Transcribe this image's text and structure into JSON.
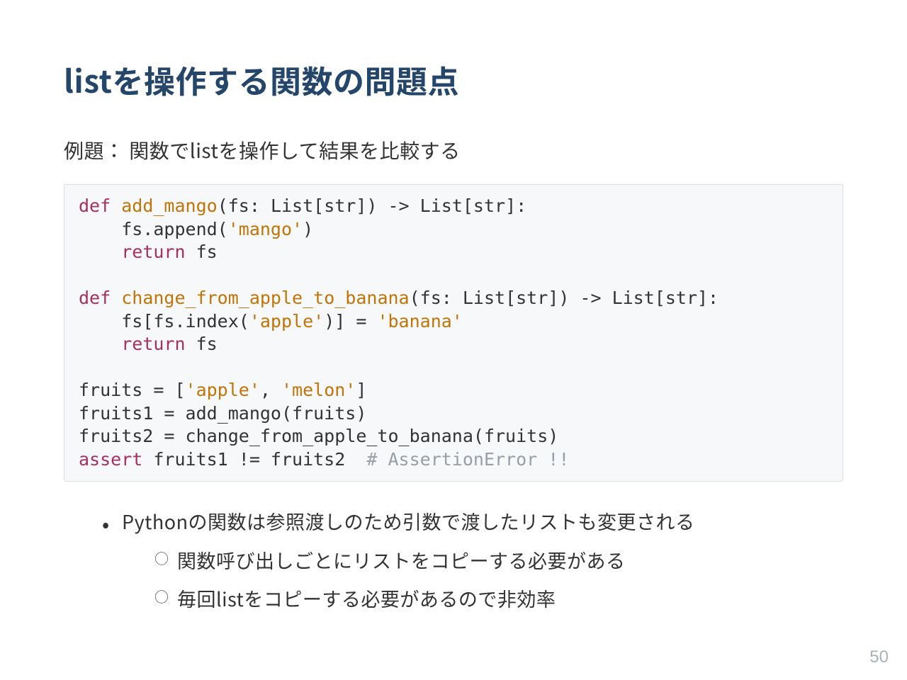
{
  "title": "listを操作する関数の問題点",
  "subtitle": "例題： 関数でlistを操作して結果を比較する",
  "code": {
    "l1a": "def",
    "l1b": "add_mango",
    "l1c": "(fs: List[str]) -> List[str]:",
    "l2a": "    fs.append(",
    "l2b": "'mango'",
    "l2c": ")",
    "l3a": "    ",
    "l3b": "return",
    "l3c": " fs",
    "l5a": "def",
    "l5b": "change_from_apple_to_banana",
    "l5c": "(fs: List[str]) -> List[str]:",
    "l6a": "    fs[fs.index(",
    "l6b": "'apple'",
    "l6c": ")] = ",
    "l6d": "'banana'",
    "l7a": "    ",
    "l7b": "return",
    "l7c": " fs",
    "l9a": "fruits = [",
    "l9b": "'apple'",
    "l9c": ", ",
    "l9d": "'melon'",
    "l9e": "]",
    "l10": "fruits1 = add_mango(fruits)",
    "l11": "fruits2 = change_from_apple_to_banana(fruits)",
    "l12a": "assert",
    "l12b": " fruits1 != fruits2  ",
    "l12c": "# AssertionError !!"
  },
  "bullets": {
    "b1": "Pythonの関数は参照渡しのため引数で渡したリストも変更される",
    "b1_1": "関数呼び出しごとにリストをコピーする必要がある",
    "b1_2": "毎回listをコピーする必要があるので非効率"
  },
  "pagenum": "50"
}
